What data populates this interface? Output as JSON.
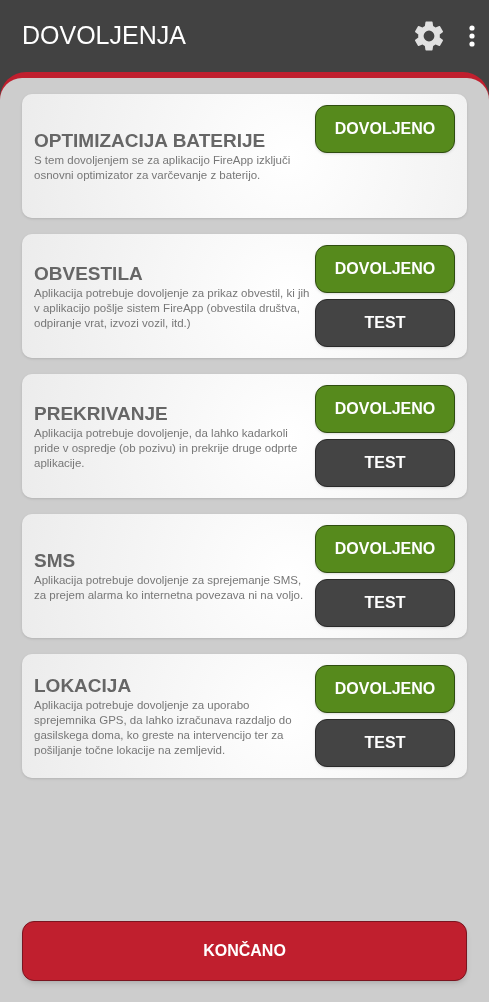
{
  "app_bar": {
    "title": "DOVOLJENJA"
  },
  "permissions": [
    {
      "title": "OPTIMIZACIJA BATERIJE",
      "description": "S tem dovoljenjem se za aplikacijo FireApp izključi osnovni optimizator za varčevanje z baterijo.",
      "buttons": [
        {
          "kind": "allow",
          "label": "DOVOLJENO"
        }
      ]
    },
    {
      "title": "OBVESTILA",
      "description": "Aplikacija potrebuje dovoljenje za prikaz obvestil, ki jih v aplikacijo pošlje sistem FireApp (obvestila društva, odpiranje vrat, izvozi vozil, itd.)",
      "buttons": [
        {
          "kind": "allow",
          "label": "DOVOLJENO"
        },
        {
          "kind": "test",
          "label": "TEST"
        }
      ]
    },
    {
      "title": "PREKRIVANJE",
      "description": "Aplikacija potrebuje dovoljenje, da lahko kadarkoli pride v ospredje (ob pozivu) in prekrije druge odprte aplikacije.",
      "buttons": [
        {
          "kind": "allow",
          "label": "DOVOLJENO"
        },
        {
          "kind": "test",
          "label": "TEST"
        }
      ]
    },
    {
      "title": "SMS",
      "description": "Aplikacija potrebuje dovoljenje za sprejemanje SMS, za prejem alarma ko internetna povezava ni na voljo.",
      "buttons": [
        {
          "kind": "allow",
          "label": "DOVOLJENO"
        },
        {
          "kind": "test",
          "label": "TEST"
        }
      ]
    },
    {
      "title": "LOKACIJA",
      "description": "Aplikacija potrebuje dovoljenje za uporabo sprejemnika GPS, da lahko izračunava razdaljo do gasilskega doma, ko greste na intervencijo ter za pošiljanje točne lokacije na zemljevid.",
      "buttons": [
        {
          "kind": "allow",
          "label": "DOVOLJENO"
        },
        {
          "kind": "test",
          "label": "TEST"
        }
      ]
    }
  ],
  "finish_button": {
    "label": "KONČANO"
  }
}
